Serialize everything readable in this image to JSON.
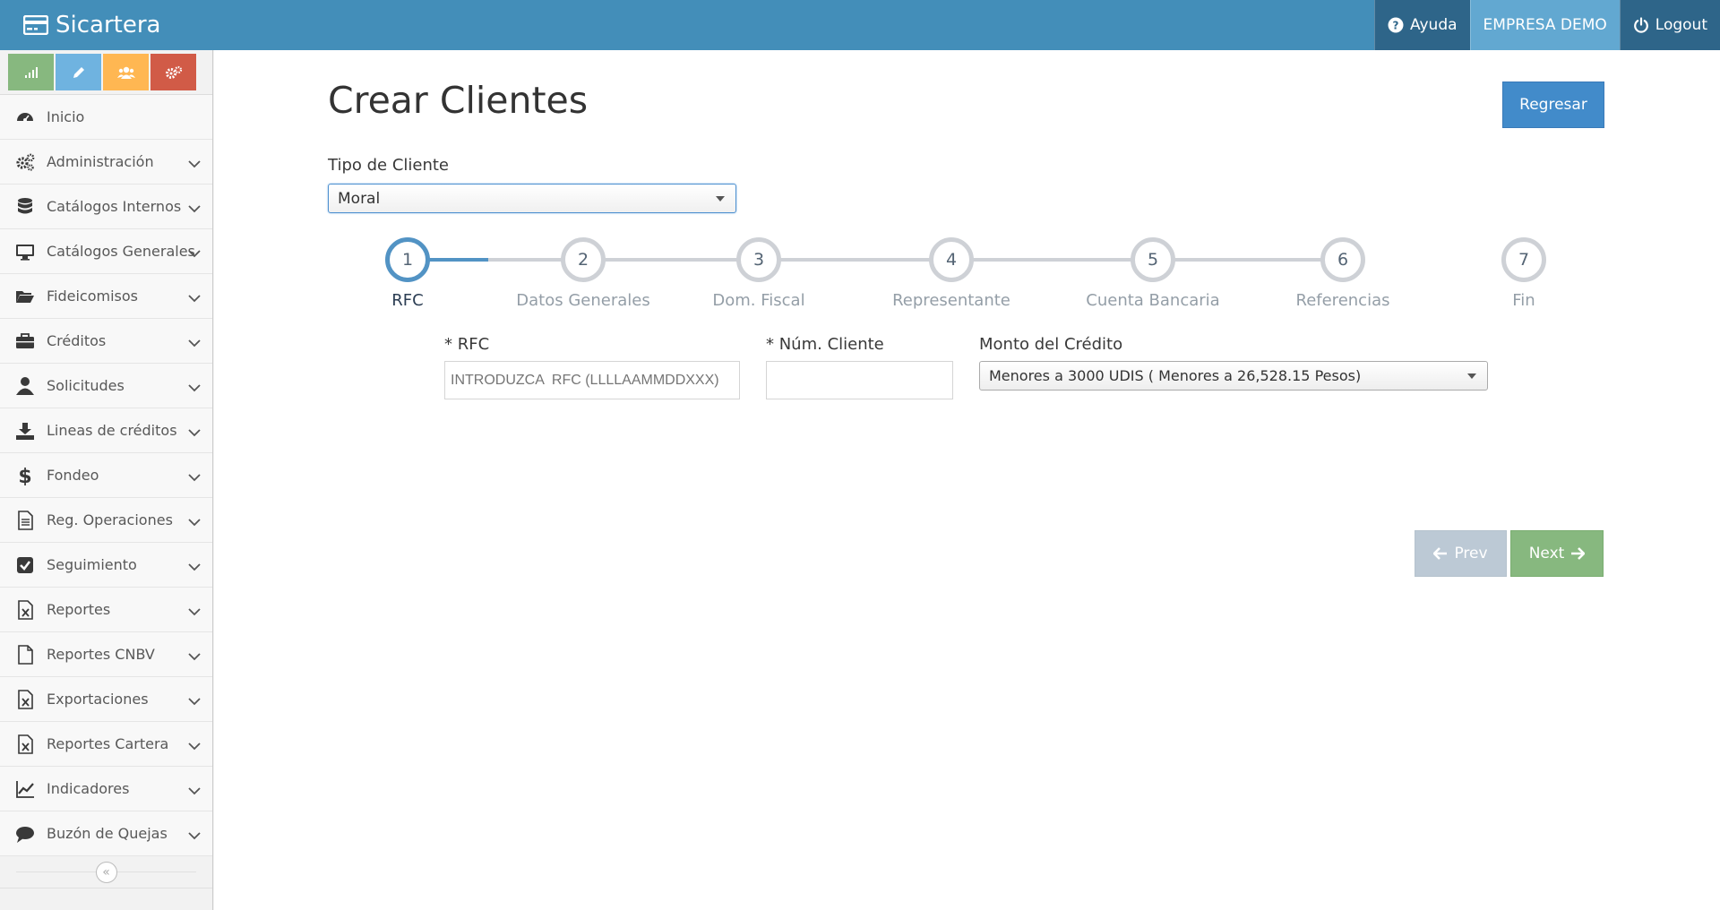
{
  "navbar": {
    "brand": "Sicartera",
    "ayuda": "Ayuda",
    "empresa": "EMPRESA DEMO",
    "logout": "Logout"
  },
  "sidebar": {
    "items": [
      {
        "label": "Inicio",
        "icon": "tachometer-icon",
        "has_arrow": false
      },
      {
        "label": "Administración",
        "icon": "cogs-icon",
        "has_arrow": true
      },
      {
        "label": "Catálogos Internos",
        "icon": "database-icon",
        "has_arrow": true
      },
      {
        "label": "Catálogos Generales",
        "icon": "desktop-icon",
        "has_arrow": true
      },
      {
        "label": "Fideicomisos",
        "icon": "folder-open-icon",
        "has_arrow": true
      },
      {
        "label": "Créditos",
        "icon": "briefcase-icon",
        "has_arrow": true
      },
      {
        "label": "Solicitudes",
        "icon": "user-icon",
        "has_arrow": true
      },
      {
        "label": "Lineas de créditos",
        "icon": "download-icon",
        "has_arrow": true
      },
      {
        "label": "Fondeo",
        "icon": "dollar-icon",
        "has_arrow": true
      },
      {
        "label": "Reg. Operaciones",
        "icon": "file-text-icon",
        "has_arrow": true
      },
      {
        "label": "Seguimiento",
        "icon": "check-square-icon",
        "has_arrow": true
      },
      {
        "label": "Reportes",
        "icon": "file-excel-icon",
        "has_arrow": true
      },
      {
        "label": "Reportes CNBV",
        "icon": "file-icon",
        "has_arrow": true
      },
      {
        "label": "Exportaciones",
        "icon": "file-excel-icon",
        "has_arrow": true
      },
      {
        "label": "Reportes Cartera",
        "icon": "file-excel-icon",
        "has_arrow": true
      },
      {
        "label": "Indicadores",
        "icon": "line-chart-icon",
        "has_arrow": true
      },
      {
        "label": "Buzón de Quejas",
        "icon": "comment-icon",
        "has_arrow": true
      }
    ],
    "toggle": "«"
  },
  "main": {
    "title": "Crear Clientes",
    "back_button": "Regresar",
    "tipo_label": "Tipo de Cliente",
    "tipo_value": "Moral",
    "steps": [
      {
        "num": "1",
        "title": "RFC"
      },
      {
        "num": "2",
        "title": "Datos Generales"
      },
      {
        "num": "3",
        "title": "Dom. Fiscal"
      },
      {
        "num": "4",
        "title": "Representante"
      },
      {
        "num": "5",
        "title": "Cuenta Bancaria"
      },
      {
        "num": "6",
        "title": "Referencias"
      },
      {
        "num": "7",
        "title": "Fin"
      }
    ],
    "active_step": 1,
    "rfc_label": "* RFC",
    "rfc_placeholder": "INTRODUZCA  RFC (LLLLAAMMDDXXX)",
    "rfc_value": "",
    "num_cliente_label": "* Núm. Cliente",
    "num_cliente_value": "",
    "monto_label": "Monto del Crédito",
    "monto_value": "Menores a 3000 UDIS ( Menores a 26,528.15 Pesos)",
    "prev_button": "Prev",
    "next_button": "Next"
  },
  "colors": {
    "navbar": "#438eb9",
    "primary": "#428bca",
    "success": "#87b87f",
    "step_active": "#5293c4"
  }
}
